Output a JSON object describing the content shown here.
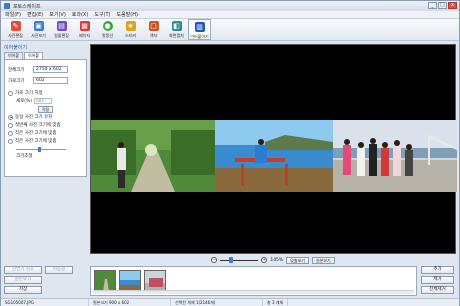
{
  "window": {
    "title": "포토스케이프",
    "controls": [
      "_",
      "□",
      "x"
    ]
  },
  "menu": [
    "파일(F)",
    "편집(E)",
    "보기(V)",
    "효과(X)",
    "도구(T)",
    "도움말(H)"
  ],
  "toolbar": [
    {
      "label": "사진편집",
      "icon": "photo-edit-icon",
      "color": "#e04d3c"
    },
    {
      "label": "사진보기",
      "icon": "viewer-icon",
      "color": "#3c7bd0"
    },
    {
      "label": "일괄편집",
      "icon": "batch-icon",
      "color": "#6b4fc2"
    },
    {
      "label": "페이지",
      "icon": "page-icon",
      "color": "#d9363e"
    },
    {
      "label": "말풍선",
      "icon": "speech-bubble-icon",
      "color": "#3aa53a"
    },
    {
      "label": "스티커",
      "icon": "sticker-icon",
      "color": "#e0a21c"
    },
    {
      "label": "액자",
      "icon": "frame-icon",
      "color": "#c8552b"
    },
    {
      "label": "화면캡처",
      "icon": "capture-icon",
      "color": "#2d8f8b"
    },
    {
      "label": "이어붙이기",
      "icon": "combine-icon",
      "color": "#1d5bb3",
      "active": true
    }
  ],
  "left_panel": {
    "section_title": "이어붙이기",
    "tabs": [
      "이어붙",
      "이어붙"
    ],
    "full_size_label": "전체크기",
    "full_size_value": "2750 x 602",
    "height_label": "가로크기",
    "height_value": "602",
    "option_fixed": "가로 크기 지정",
    "width_label": "세로(%)",
    "width_value": "602",
    "apply_label": "적용",
    "option_same": "동일 사진 크기 유지",
    "option_fit_first": "첫번째 사진 크기에 맞춤",
    "option_fit_small": "작은 사진 크기에 맞춤",
    "option_fit_large": "작은 사진 크기에 맞춤",
    "zoom_label": "크기조절"
  },
  "bottom_left": {
    "btn1": "전면기 취소",
    "btn2": "이동정",
    "btn3": "원본보기",
    "btn4": "저장"
  },
  "zoom": {
    "value": "145%",
    "fit_label": "맞춤보기",
    "original_label": "원본보기"
  },
  "right_buttons": [
    "추가",
    "제거",
    "전체제거"
  ],
  "status": {
    "filename": "SG105007.JPG",
    "original_size": "원본크기 900 x 602",
    "selected": "선택된 개체 1(2146개)",
    "count": "총 3 개체"
  },
  "colors": {
    "accent": "#1e4f9a",
    "sky": "#6fb5e8",
    "sea": "#3a8ccf",
    "trees": "#3e7a2b",
    "road": "#b9b49a"
  }
}
